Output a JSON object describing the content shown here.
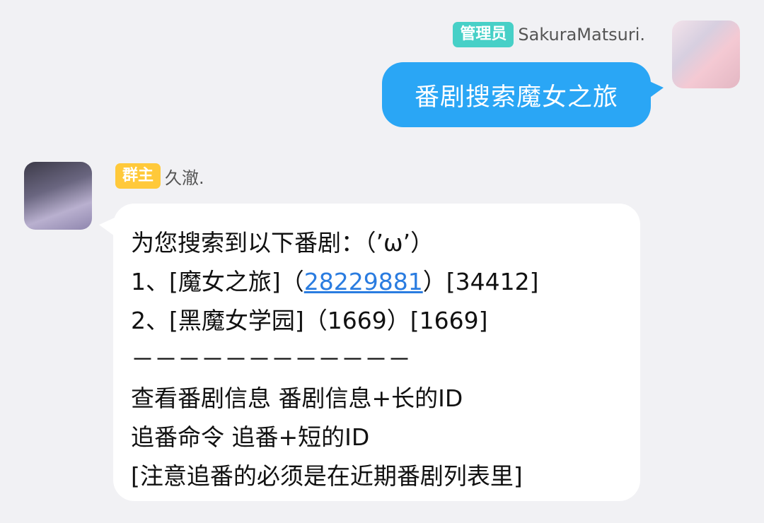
{
  "outgoing": {
    "badge": "管理员",
    "sender": "SakuraMatsuri.",
    "text": "番剧搜索魔女之旅"
  },
  "incoming": {
    "badge": "群主",
    "sender": "久澈.",
    "lines": {
      "l1": "为您搜索到以下番剧：（’ω’）",
      "l2_pre": "1、[魔女之旅]（",
      "l2_link": "28229881",
      "l2_post": "）[34412]",
      "l3": "2、[黑魔女学园]（1669）[1669]",
      "l4": "－－－－－－－－－－－－",
      "l5": "查看番剧信息 番剧信息+长的ID",
      "l6": "追番命令  追番+短的ID",
      "l7": "[注意追番的必须是在近期番剧列表里]"
    }
  },
  "colors": {
    "background": "#f1f1f4",
    "outgoing_bubble": "#2aa6f5",
    "admin_badge": "#47d0c7",
    "owner_badge": "#ffc93a",
    "link": "#2a7ce0"
  }
}
